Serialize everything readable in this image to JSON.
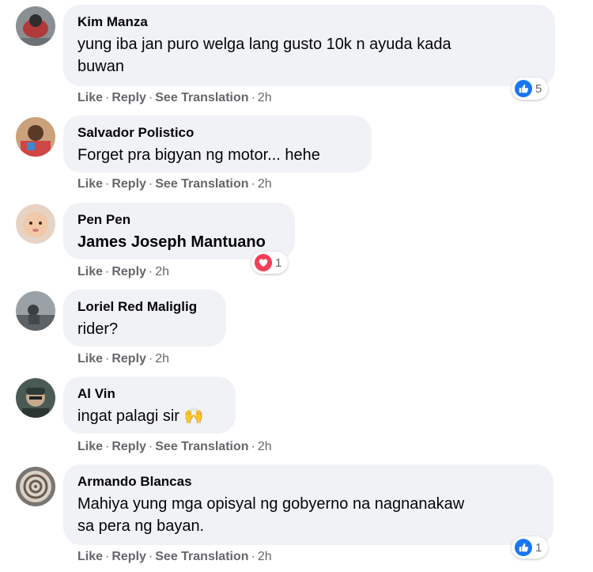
{
  "actions": {
    "like": "Like",
    "reply": "Reply",
    "see_translation": "See Translation",
    "separator": "·"
  },
  "comments": [
    {
      "author": "Kim Manza",
      "lines": [
        "yung iba jan puro welga lang gusto 10k n ayuda kada",
        "buwan"
      ],
      "time": "2h",
      "reaction": {
        "icon": "like-reaction-icon",
        "count": "5"
      }
    },
    {
      "author": "Salvador Polistico",
      "lines": [
        "Forget pra bigyan ng motor... hehe"
      ],
      "time": "2h"
    },
    {
      "author": "Pen Pen",
      "lines": [
        "James Joseph Mantuano"
      ],
      "time": "2h",
      "reaction": {
        "icon": "love-reaction-icon",
        "count": "1"
      }
    },
    {
      "author": "Loriel Red Maliglig",
      "lines": [
        "rider?"
      ],
      "time": "2h"
    },
    {
      "author": "Al Vin",
      "lines": [
        "ingat palagi sir 🙌"
      ],
      "time": "2h"
    },
    {
      "author": "Armando Blancas",
      "lines": [
        "Mahiya yung mga opisyal ng gobyerno na nagnanakaw",
        "sa pera ng bayan."
      ],
      "time": "2h",
      "reaction": {
        "icon": "like-reaction-icon",
        "count": "1"
      }
    }
  ],
  "colors": {
    "bubble": "#f0f2f5",
    "secondary_text": "#65676b",
    "like_blue": "#1877f2",
    "love_red": "#f33e58"
  }
}
